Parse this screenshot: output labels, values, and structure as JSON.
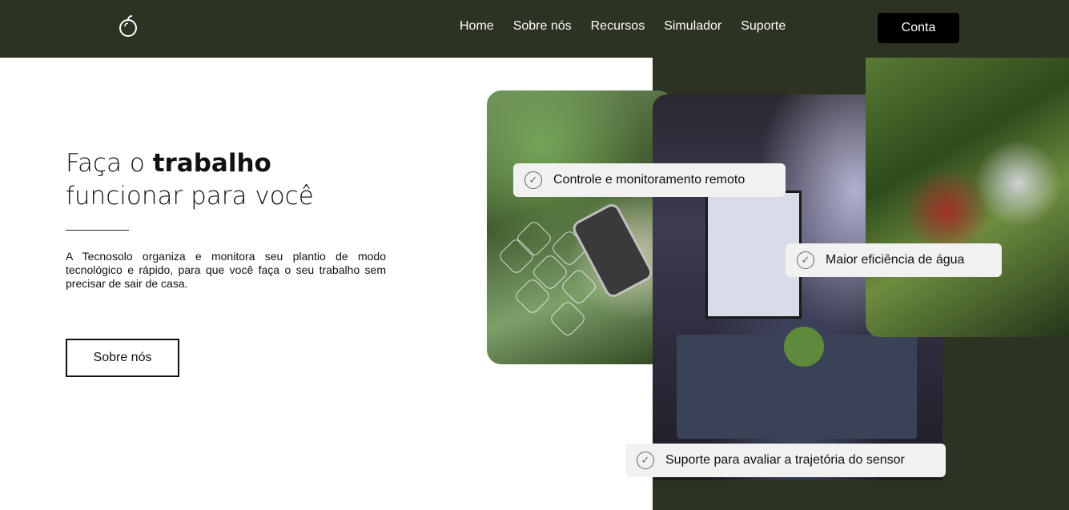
{
  "nav": {
    "logo_icon": "apple-leaf-icon",
    "items": [
      "Home",
      "Sobre nós",
      "Recursos",
      "Simulador",
      "Suporte"
    ],
    "account_label": "Conta"
  },
  "hero": {
    "headline_part1": "Faça o ",
    "headline_bold": "trabalho",
    "headline_line2": "funcionar para você",
    "description": "A Tecnosolo organiza e monitora seu plantio de modo tecnológico e rápido, para que você faça o seu trabalho sem precisar de sair de casa.",
    "button_label": "Sobre nós"
  },
  "features": [
    "Controle e monitoramento remoto",
    "Maior eficiência de água",
    "Suporte para avaliar a trajetória do sensor"
  ],
  "colors": {
    "dark_green": "#2c3322",
    "black": "#000000",
    "badge_bg": "#f1f1f1"
  }
}
